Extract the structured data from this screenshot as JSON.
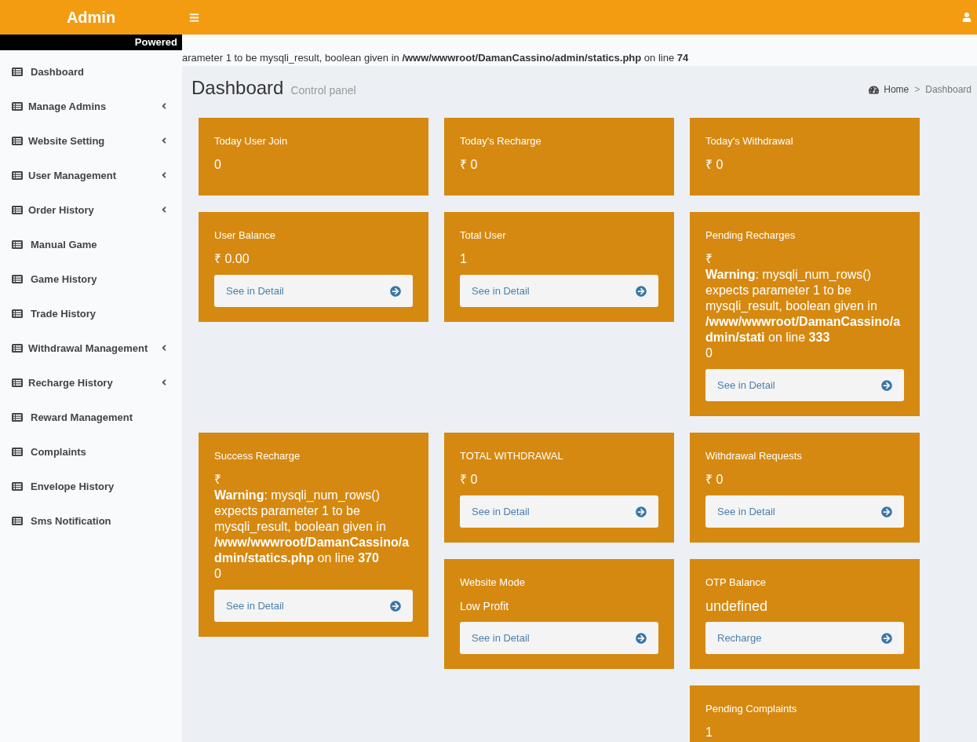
{
  "topbar": {
    "logo": "Admin",
    "powered_by": "Powered"
  },
  "notice": "arameter 1 to be mysqli_result, boolean given in **/www/wwwroot/DamanCassino/admin/statics.php** on line **74**",
  "sidebar": {
    "items": [
      {
        "label": "Dashboard",
        "kind": "link"
      },
      {
        "label": "Manage Admins",
        "kind": "submenu"
      },
      {
        "label": "Website Setting",
        "kind": "submenu"
      },
      {
        "label": "User Management",
        "kind": "submenu"
      },
      {
        "label": "Order History",
        "kind": "submenu"
      },
      {
        "label": "Manual Game",
        "kind": "link"
      },
      {
        "label": "Game History",
        "kind": "link"
      },
      {
        "label": "Trade History",
        "kind": "link"
      },
      {
        "label": "Withdrawal Management",
        "kind": "submenu"
      },
      {
        "label": "Recharge History",
        "kind": "submenu"
      },
      {
        "label": "Reward Management",
        "kind": "link"
      },
      {
        "label": "Complaints",
        "kind": "link"
      },
      {
        "label": "Envelope History",
        "kind": "link"
      },
      {
        "label": "Sms Notification",
        "kind": "link"
      }
    ]
  },
  "page_header": {
    "title": "Dashboard",
    "subtitle": "Control panel",
    "breadcrumb": {
      "home": "Home",
      "separator": ">",
      "current": "Dashboard"
    }
  },
  "card_rows": [
    {
      "columns": [
        {
          "cards": [
            {
              "kind": "count",
              "title": "Today User Join",
              "value": "0"
            }
          ]
        },
        {
          "cards": [
            {
              "kind": "count",
              "title": "Today's Recharge",
              "value": "₹ 0"
            }
          ]
        },
        {
          "cards": [
            {
              "kind": "count",
              "title": "Today's Withdrawal",
              "value": "₹ 0"
            }
          ]
        }
      ]
    },
    {
      "columns": [
        {
          "cards": [
            {
              "kind": "count",
              "title": "User Balance",
              "value": "₹ 0.00",
              "button": "See in Detail"
            }
          ]
        },
        {
          "cards": [
            {
              "kind": "count",
              "title": "Total User",
              "value": "1",
              "button": "See in Detail"
            }
          ]
        },
        {
          "cards": [
            {
              "kind": "count",
              "title": "Pending Recharges",
              "value": "₹\n**Warning**: mysqli_num_rows() expects parameter 1 to be mysqli_result, boolean given in **/www/wwwroot/DamanCassino/admin/stati** on line **333**\n0",
              "button": "See in Detail"
            }
          ]
        }
      ]
    },
    {
      "columns": [
        {
          "cards": [
            {
              "kind": "count",
              "title": "Success Recharge",
              "value": "₹\n**Warning**: mysqli_num_rows() expects parameter 1 to be mysqli_result, boolean given in **/www/wwwroot/DamanCassino/admin/statics.php** on line **370**\n0",
              "button": "See in Detail"
            }
          ]
        },
        {
          "cards": [
            {
              "kind": "count",
              "title": "TOTAL WITHDRAWAL",
              "value": "₹ 0",
              "button": "See in Detail"
            },
            {
              "kind": "mode",
              "title": "Website Mode",
              "value": "Low Profit",
              "button": "See in Detail"
            }
          ]
        },
        {
          "cards": [
            {
              "kind": "count",
              "title": "Withdrawal Requests",
              "value": "₹ 0",
              "button": "See in Detail"
            },
            {
              "kind": "balance",
              "title": "OTP Balance",
              "value": "undefined",
              "button": "Recharge"
            },
            {
              "kind": "count",
              "title": "Pending Complaints",
              "value": "1"
            }
          ]
        }
      ]
    }
  ]
}
